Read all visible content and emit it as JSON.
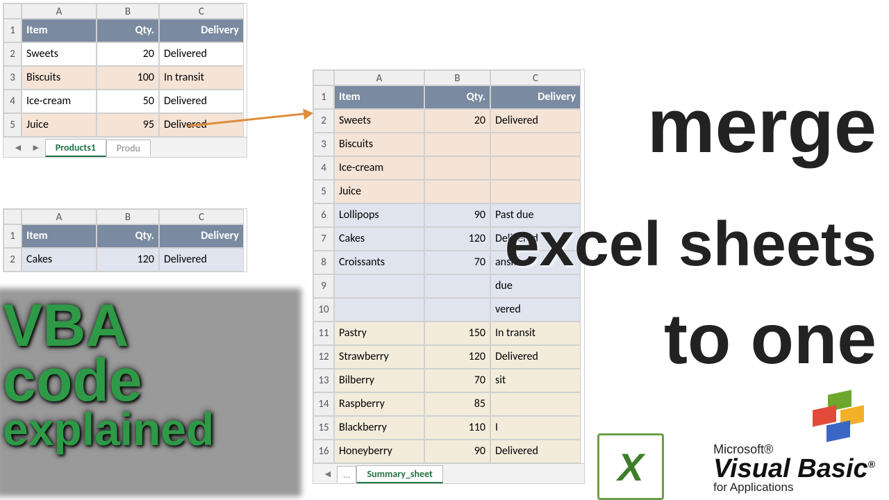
{
  "table1": {
    "cols": [
      "A",
      "B",
      "C"
    ],
    "headers": [
      "Item",
      "Qty.",
      "Delivery"
    ],
    "rows": [
      {
        "n": "1"
      },
      {
        "n": "2",
        "item": "Sweets",
        "qty": "20",
        "del": "Delivered"
      },
      {
        "n": "3",
        "item": "Biscuits",
        "qty": "100",
        "del": "In transit"
      },
      {
        "n": "4",
        "item": "Ice-cream",
        "qty": "50",
        "del": "Delivered"
      },
      {
        "n": "5",
        "item": "Juice",
        "qty": "95",
        "del": "Delivered"
      }
    ],
    "tab_active": "Products1",
    "tab_other": "Produ"
  },
  "table2": {
    "cols": [
      "A",
      "B",
      "C"
    ],
    "headers": [
      "Item",
      "Qty.",
      "Delivery"
    ],
    "rows": [
      {
        "n": "1"
      },
      {
        "n": "2",
        "item": "Cakes",
        "qty": "120",
        "del": "Delivered"
      }
    ]
  },
  "table3": {
    "cols": [
      "A",
      "B",
      "C"
    ],
    "headers": [
      "Item",
      "Qty.",
      "Delivery"
    ],
    "rows": [
      {
        "n": "1"
      },
      {
        "n": "2",
        "item": "Sweets",
        "qty": "20",
        "del": "Delivered"
      },
      {
        "n": "3",
        "item": "Biscuits",
        "qty": "",
        "del": ""
      },
      {
        "n": "4",
        "item": "Ice-cream",
        "qty": "",
        "del": ""
      },
      {
        "n": "5",
        "item": "Juice",
        "qty": "",
        "del": ""
      },
      {
        "n": "6",
        "item": "Lollipops",
        "qty": "90",
        "del": "Past due"
      },
      {
        "n": "7",
        "item": "Cakes",
        "qty": "120",
        "del": "Delivered"
      },
      {
        "n": "8",
        "item": "Croissants",
        "qty": "70",
        "del": "ansit"
      },
      {
        "n": "9",
        "item": "",
        "qty": "",
        "del": "due"
      },
      {
        "n": "10",
        "item": "",
        "qty": "",
        "del": "vered"
      },
      {
        "n": "11",
        "item": "Pastry",
        "qty": "150",
        "del": "In transit"
      },
      {
        "n": "12",
        "item": "Strawberry",
        "qty": "120",
        "del": "Delivered"
      },
      {
        "n": "13",
        "item": "Bilberry",
        "qty": "70",
        "del": "sit"
      },
      {
        "n": "14",
        "item": "Raspberry",
        "qty": "85",
        "del": ""
      },
      {
        "n": "15",
        "item": "Blackberry",
        "qty": "110",
        "del": "I"
      },
      {
        "n": "16",
        "item": "Honeyberry",
        "qty": "90",
        "del": "Delivered"
      }
    ],
    "tab_active": "Summary_sheet",
    "tab_ell": "..."
  },
  "titles": {
    "merge": "merge",
    "excel_sheets": "excel sheets",
    "to_one": "to one",
    "vba": "VBA",
    "code": "code",
    "explained": "explained"
  },
  "logo": {
    "ms": "Microsoft®",
    "vb": "Visual Basic",
    "app": "for Applications"
  }
}
